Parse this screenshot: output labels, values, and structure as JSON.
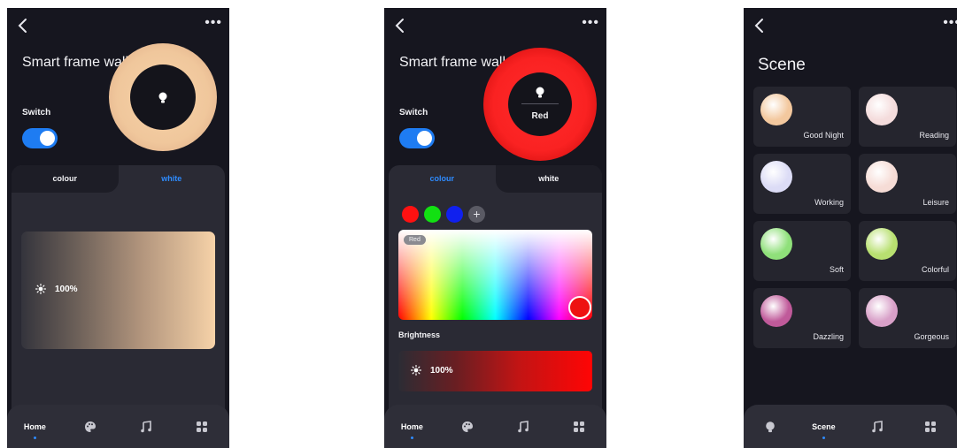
{
  "screens": [
    {
      "device_title": "Smart frame wall.",
      "switch_label": "Switch",
      "switch_on": true,
      "tabs": [
        {
          "label": "colour",
          "active": false
        },
        {
          "label": "white",
          "active": true
        }
      ],
      "brightness_value": "100%",
      "lamp_color": "#f6d2a8",
      "nav": [
        {
          "label": "Home",
          "icon": "home",
          "active": true
        },
        {
          "label": "",
          "icon": "palette-icon",
          "active": false
        },
        {
          "label": "",
          "icon": "music-icon",
          "active": false
        },
        {
          "label": "",
          "icon": "grid-icon",
          "active": false
        }
      ]
    },
    {
      "device_title": "Smart frame wall.",
      "switch_label": "Switch",
      "switch_on": true,
      "ring_label": "Red",
      "tabs": [
        {
          "label": "colour",
          "active": true
        },
        {
          "label": "white",
          "active": false
        }
      ],
      "preset_colors": [
        "#ff1111",
        "#12e012",
        "#1020ee"
      ],
      "picker_chip": "Red",
      "brightness_label": "Brightness",
      "brightness_value": "100%",
      "lamp_color": "#ff1f1f",
      "nav": [
        {
          "label": "Home",
          "icon": "home",
          "active": true
        },
        {
          "label": "",
          "icon": "palette-icon",
          "active": false
        },
        {
          "label": "",
          "icon": "music-icon",
          "active": false
        },
        {
          "label": "",
          "icon": "grid-icon",
          "active": false
        }
      ]
    },
    {
      "title": "Scene",
      "scenes": [
        {
          "name": "Good Night",
          "color": "#f3c89e"
        },
        {
          "name": "Reading",
          "color": "#f4dcdc"
        },
        {
          "name": "Working",
          "color": "#dcdcf6"
        },
        {
          "name": "Leisure",
          "color": "#f6dcd6"
        },
        {
          "name": "Soft",
          "color": "#8fe07a"
        },
        {
          "name": "Colorful",
          "color": "#b8e070"
        },
        {
          "name": "Dazzling",
          "color": "#c05a9a"
        },
        {
          "name": "Gorgeous",
          "color": "#d8a0c8"
        }
      ],
      "nav": [
        {
          "label": "",
          "icon": "bulb-icon",
          "active": false
        },
        {
          "label": "Scene",
          "icon": "scene",
          "active": true
        },
        {
          "label": "",
          "icon": "music-icon",
          "active": false
        },
        {
          "label": "",
          "icon": "grid-icon",
          "active": false
        }
      ]
    }
  ],
  "colors": {
    "accent": "#2e8bff",
    "toggle": "#1e7cf2",
    "background": "#16161f"
  }
}
